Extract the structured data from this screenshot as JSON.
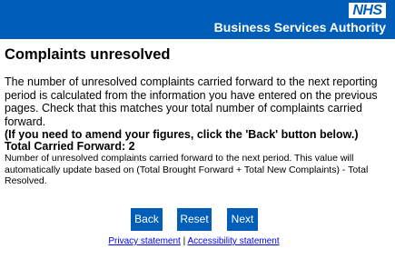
{
  "header": {
    "logo_text": "NHS",
    "org_name": "Business Services Authority",
    "bg_color": "#005EB8"
  },
  "page": {
    "title": "Complaints unresolved",
    "intro_text": "The number of unresolved complaints carried forward to the next reporting period is calculated from the information you have entered on the previous pages. Check that this matches your total number of complaints carried forward.",
    "intro_bold": "(If you need to amend your figures, click the 'Back' button below.)",
    "total_label": "Total Carried Forward: 2",
    "total_description": "Number of unresolved complaints carried forward to the next period. This value will automatically update based on (Total Brought Forward + Total New Complaints) - Total Resolved."
  },
  "buttons": {
    "back": "Back",
    "reset": "Reset",
    "next": "Next",
    "color": "#005EB8"
  },
  "footer": {
    "privacy": "Privacy statement",
    "separator": "|",
    "accessibility": "Accessibility statement"
  }
}
